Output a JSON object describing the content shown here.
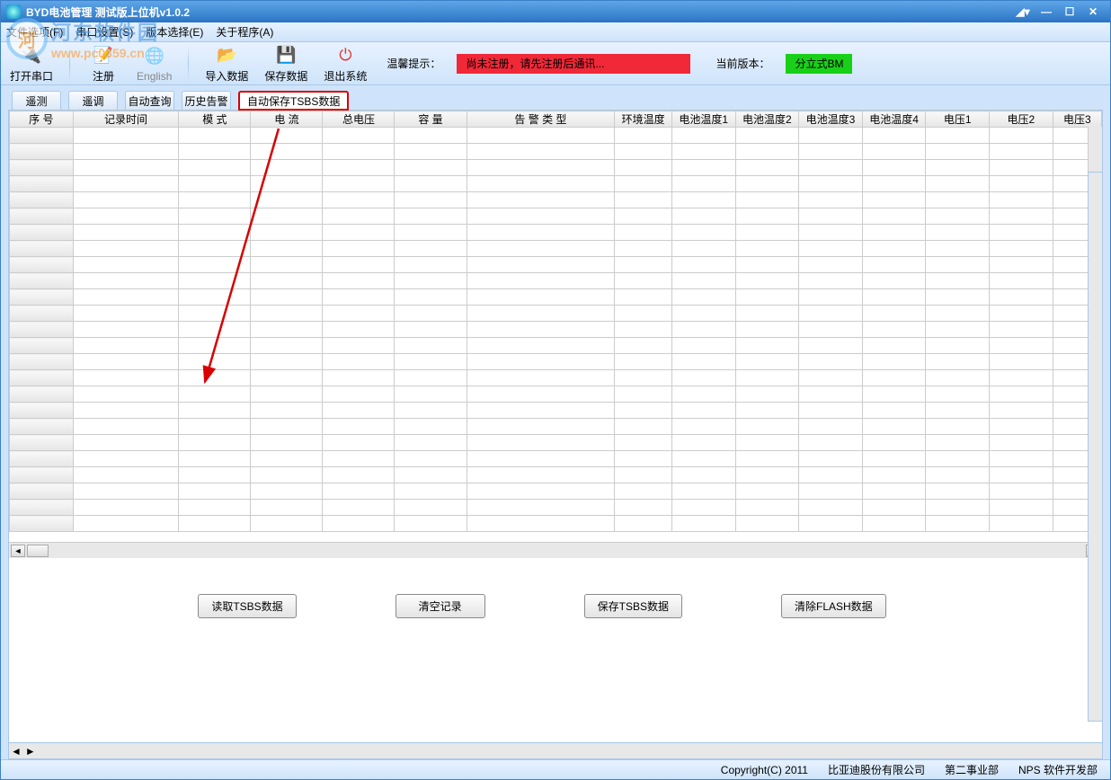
{
  "title": "BYD电池管理 测试版上位机v1.0.2",
  "menu": {
    "file": "文件选项(F)",
    "serial": "串口设置(S)",
    "version": "版本选择(E)",
    "about": "关于程序(A)"
  },
  "watermark": {
    "cn": "河东软件园",
    "url": "www.pc0359.cn"
  },
  "toolbar": {
    "open_port": "打开串口",
    "register": "注册",
    "english": "English",
    "import": "导入数据",
    "save": "保存数据",
    "exit": "退出系统",
    "warm_label": "温馨提示：",
    "warm_msg": "尚未注册，请先注册后通讯...",
    "ver_label": "当前版本：",
    "ver_value": "分立式BM"
  },
  "tabs": {
    "t1": "遥测",
    "t2": "遥调",
    "t3": "自动查询",
    "t4": "历史告警",
    "t5": "自动保存TSBS数据"
  },
  "columns": {
    "c0": "序 号",
    "c1": "记录时间",
    "c2": "模 式",
    "c3": "电 流",
    "c4": "总电压",
    "c5": "容 量",
    "c6": "告 警 类 型",
    "c7": "环境温度",
    "c8": "电池温度1",
    "c9": "电池温度2",
    "c10": "电池温度3",
    "c11": "电池温度4",
    "c12": "电压1",
    "c13": "电压2",
    "c14": "电压3"
  },
  "buttons": {
    "b1": "读取TSBS数据",
    "b2": "清空记录",
    "b3": "保存TSBS数据",
    "b4": "清除FLASH数据"
  },
  "status": {
    "copyright": "Copyright(C)  2011",
    "company": "比亚迪股份有限公司",
    "dept": "第二事业部",
    "team": "NPS 软件开发部"
  }
}
